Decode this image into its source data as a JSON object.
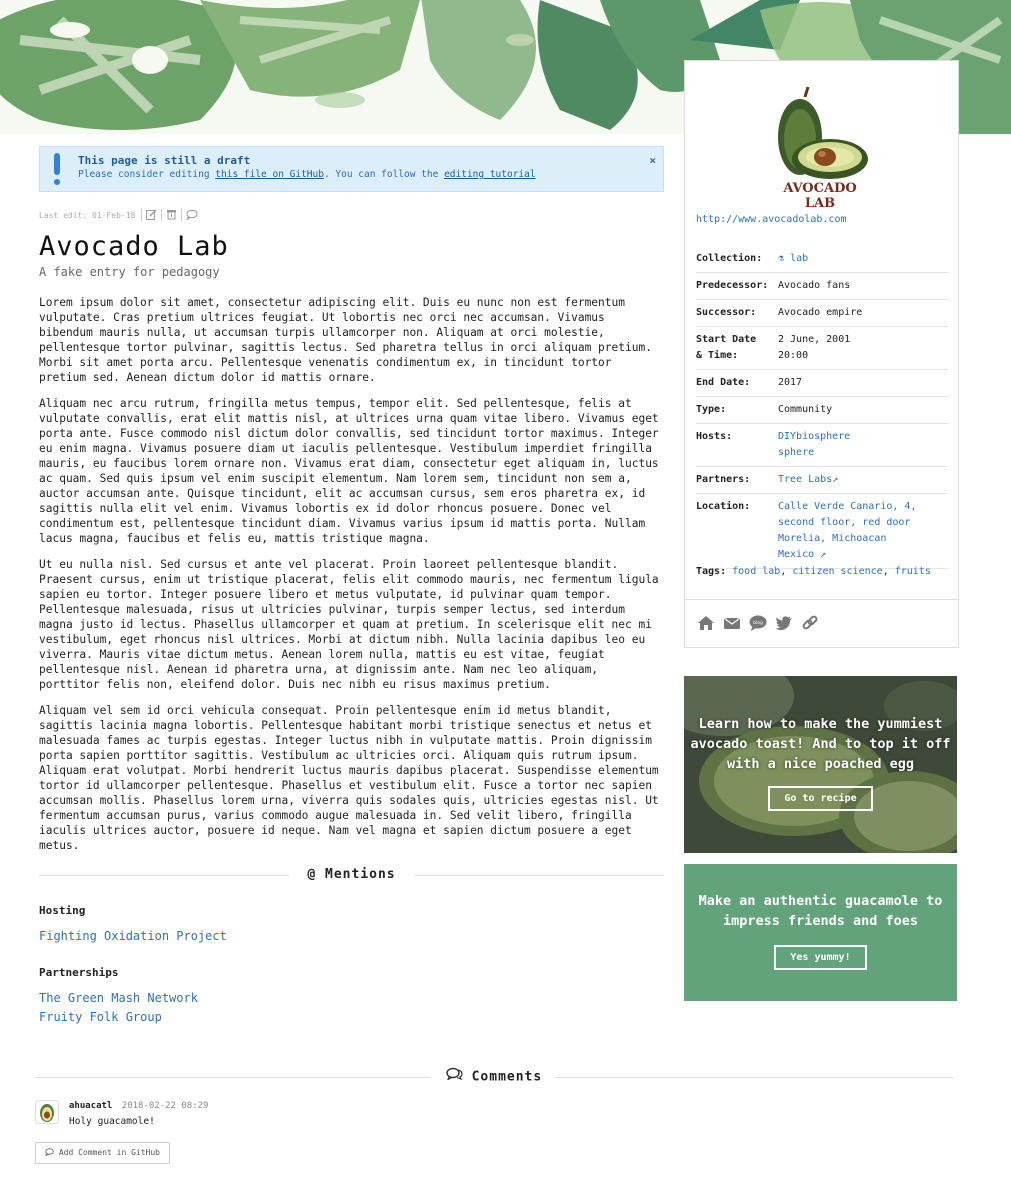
{
  "draft": {
    "title": "This page is still a draft",
    "text_before": "Please consider editing ",
    "link_file": "this file on GitHub",
    "text_middle": ". You can follow the ",
    "link_tutorial": "editing tutorial",
    "close": "×"
  },
  "meta": {
    "last_edit": "Last edit: 01-Feb-18"
  },
  "entry": {
    "title": "Avocado Lab",
    "subtitle": "A fake entry for pedagogy",
    "paragraphs": [
      "Lorem ipsum dolor sit amet, consectetur adipiscing elit. Duis eu nunc non est fermentum vulputate. Cras pretium ultrices feugiat. Ut lobortis nec orci nec accumsan. Vivamus bibendum mauris nulla, ut accumsan turpis ullamcorper non. Aliquam at orci molestie, pellentesque tortor pulvinar, sagittis lectus. Sed pharetra tellus in orci aliquam pretium. Morbi sit amet porta arcu. Pellentesque venenatis condimentum ex, in tincidunt tortor pretium sed. Aenean dictum dolor id mattis ornare.",
      "Aliquam nec arcu rutrum, fringilla metus tempus, tempor elit. Sed pellentesque, felis at vulputate convallis, erat elit mattis nisl, at ultrices urna quam vitae libero. Vivamus eget porta ante. Fusce commodo nisl dictum dolor convallis, sed tincidunt tortor maximus. Integer eu enim magna. Vivamus posuere diam ut iaculis pellentesque. Vestibulum imperdiet fringilla mauris, eu faucibus lorem ornare non. Vivamus erat diam, consectetur eget aliquam in, luctus ac quam. Sed quis ipsum vel enim suscipit elementum. Nam lorem sem, tincidunt non sem a, auctor accumsan ante. Quisque tincidunt, elit ac accumsan cursus, sem eros pharetra ex, id sagittis nulla elit vel enim. Vivamus lobortis ex id dolor rhoncus posuere. Donec vel condimentum est, pellentesque tincidunt diam. Vivamus varius ipsum id mattis porta. Nullam lacus magna, faucibus et felis eu, mattis tristique magna.",
      "Ut eu nulla nisl. Sed cursus et ante vel placerat. Proin laoreet pellentesque blandit. Praesent cursus, enim ut tristique placerat, felis elit commodo mauris, nec fermentum ligula sapien eu tortor. Integer posuere libero et metus vulputate, id pulvinar quam tempor. Pellentesque malesuada, risus ut ultricies pulvinar, turpis semper lectus, sed interdum magna justo id lectus. Phasellus ullamcorper et quam at pretium. In scelerisque elit nec mi vestibulum, eget rhoncus nisl ultrices. Morbi at dictum nibh. Nulla lacinia dapibus leo eu viverra. Mauris vitae dictum metus. Aenean lorem nulla, mattis eu est vitae, feugiat pellentesque nisl. Aenean id pharetra urna, at dignissim ante. Nam nec leo aliquam, porttitor felis non, eleifend dolor. Duis nec nibh eu risus maximus pretium.",
      "Aliquam vel sem id orci vehicula consequat. Proin pellentesque enim id metus blandit, sagittis lacinia magna lobortis. Pellentesque habitant morbi tristique senectus et netus et malesuada fames ac turpis egestas. Integer luctus nibh in vulputate mattis. Proin dignissim porta sapien porttitor sagittis. Vestibulum ac ultricies orci. Aliquam quis rutrum ipsum. Aliquam erat volutpat. Morbi hendrerit luctus mauris dapibus placerat. Suspendisse elementum tortor id ullamcorper pellentesque. Phasellus et vestibulum elit. Fusce a tortor nec sapien accumsan mollis. Phasellus lorem urna, viverra quis sodales quis, ultricies egestas nisl. Ut fermentum accumsan purus, varius commodo augue malesuada in. Sed velit libero, fringilla iaculis ultrices auctor, posuere id neque. Nam vel magna et sapien dictum posuere a eget metus."
    ]
  },
  "mentions": {
    "heading": "@ Mentions",
    "groups": [
      {
        "label": "Hosting",
        "links": [
          "Fighting Oxidation Project"
        ]
      },
      {
        "label": "Partnerships",
        "links": [
          "The Green Mash Network",
          "Fruity Folk Group"
        ]
      }
    ]
  },
  "sidebar": {
    "logo_text": "AVOCADO LAB",
    "url": "http://www.avocadolab.com",
    "props": {
      "collection_k": "Collection:",
      "collection_v": "lab",
      "predecessor_k": "Predecessor:",
      "predecessor_v": "Avocado fans",
      "successor_k": "Successor:",
      "successor_v": "Avocado empire",
      "start_k1": "Start Date",
      "start_k2": "& Time:",
      "start_v1": "2 June, 2001",
      "start_v2": "20:00",
      "end_k": "End Date:",
      "end_v": "2017",
      "type_k": "Type:",
      "type_v": "Community",
      "hosts_k": "Hosts:",
      "hosts_v1": "DIYbiosphere",
      "hosts_v2": "sphere",
      "partners_k": "Partners:",
      "partners_v": "Tree Labs",
      "location_k": "Location:",
      "location_v1": "Calle Verde Canario, 4,",
      "location_v2": "second floor, red door",
      "location_v3": "Morelia, Michoacan",
      "location_v4": "Mexico"
    },
    "tags_label": "Tags:",
    "tags": [
      "food lab",
      "citizen science",
      "fruits"
    ],
    "social_icons": [
      "home-icon",
      "envelope-icon",
      "blog-icon",
      "twitter-icon",
      "link-icon"
    ]
  },
  "promos": {
    "p1_text": "Learn how to make the yummiest avocado toast! And to top it off with a nice poached egg",
    "p1_button": "Go to recipe",
    "p2_text": "Make an authentic guacamole to impress friends and foes",
    "p2_button": "Yes yummy!"
  },
  "comments": {
    "heading": "Comments",
    "items": [
      {
        "user": "ahuacatl",
        "date": "2018-02-22 08:29",
        "text": "Holy guacamole!"
      }
    ],
    "add_button": "Add Comment in GitHub"
  },
  "colors": {
    "link": "#2f70b7",
    "draft_bg": "#ddeefb",
    "promo_green": "#62a37c"
  }
}
